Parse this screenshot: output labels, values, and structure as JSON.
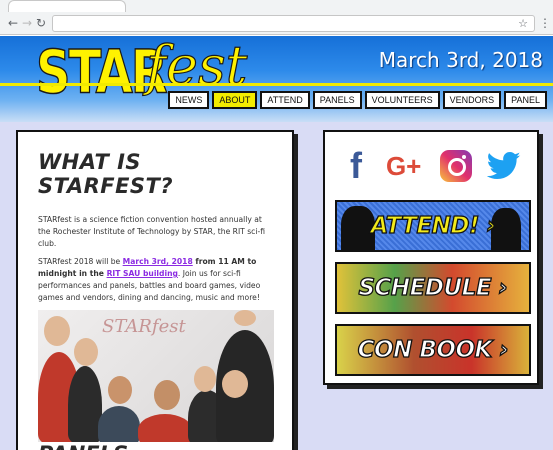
{
  "browser": {
    "back_icon": "back-arrow-icon",
    "forward_icon": "forward-arrow-icon",
    "reload_icon": "reload-icon",
    "bookmark_icon": "star-icon",
    "menu_icon": "kebab-menu-icon",
    "address_value": ""
  },
  "header": {
    "logo_part1": "STAR",
    "logo_part2": "fest",
    "date": "March 3rd, 2018",
    "nav": [
      "NEWS",
      "ABOUT",
      "ATTEND",
      "PANELS",
      "VOLUNTEERS",
      "VENDORS",
      "PANEL"
    ],
    "active_nav": "ABOUT",
    "colors": {
      "accent_yellow": "#f3ec00",
      "banner_blue": "#1670d8",
      "page_bg": "#d9dcf5"
    }
  },
  "main": {
    "heading": "WHAT IS STARFEST?",
    "para1": "STARfest is a science fiction convention hosted annually at the Rochester Institute of Technology by STAR, the RIT sci-fi club.",
    "para2_prefix": "STARfest 2018 will be ",
    "para2_date": "March 3rd, 2018",
    "para2_mid": " from 11 AM to midnight in the ",
    "para2_link": "RIT SAU building",
    "para2_suffix": ".  Join us for sci-fi performances and panels, battles and board games, video games and vendors, dining and dancing, music and more!",
    "photo_whiteboard": "STARfest",
    "heading2": "PANELS"
  },
  "sidebar": {
    "social": [
      "facebook-icon",
      "google-plus-icon",
      "instagram-icon",
      "twitter-icon"
    ],
    "google_plus_text": "G+",
    "facebook_text": "f",
    "buttons": {
      "attend": "ATTEND! ›",
      "schedule": "SCHEDULE ›",
      "con_book": "CON BOOK ›"
    }
  }
}
